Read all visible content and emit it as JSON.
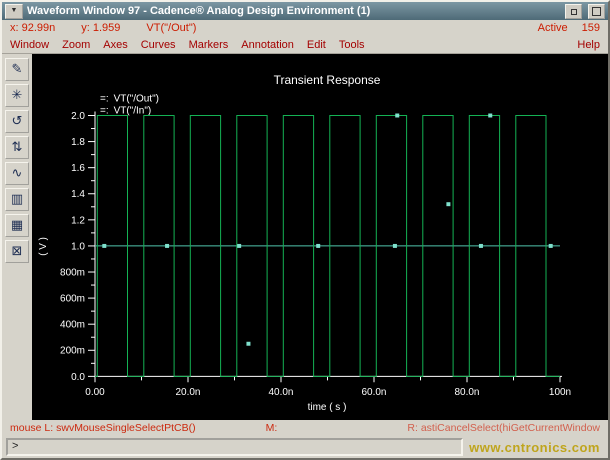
{
  "window": {
    "title": "Waveform Window 97 - Cadence® Analog Design Environment (1)"
  },
  "status_top": {
    "x": "x: 92.99n",
    "y": "y: 1.959",
    "trace": "VT(\"/Out\")",
    "active": "Active",
    "count": "159"
  },
  "menu": {
    "items": [
      "Window",
      "Zoom",
      "Axes",
      "Curves",
      "Markers",
      "Annotation",
      "Edit",
      "Tools"
    ],
    "help": "Help"
  },
  "toolbar": {
    "icons": [
      {
        "name": "probe-pen-icon",
        "glyph": "✎"
      },
      {
        "name": "asterisk-icon",
        "glyph": "✳"
      },
      {
        "name": "redraw-icon",
        "glyph": "↺"
      },
      {
        "name": "zoom-fit-icon",
        "glyph": "⇅"
      },
      {
        "name": "strip-wave-icon",
        "glyph": "∿"
      },
      {
        "name": "subwindow-icon",
        "glyph": "▥"
      },
      {
        "name": "grid-icon",
        "glyph": "▦"
      },
      {
        "name": "close-box-icon",
        "glyph": "⊠"
      }
    ]
  },
  "plot": {
    "title": "Transient Response",
    "legend_prefix": "=:",
    "ylabel": "( V )",
    "xlabel": "time ( s )"
  },
  "chart_data": {
    "type": "line",
    "title": "Transient Response",
    "xlabel": "time ( s )",
    "ylabel": "(V)",
    "xunit": "ns",
    "xlim": [
      0,
      100
    ],
    "ylim": [
      0,
      2
    ],
    "xticks": [
      "0.00",
      "20.0n",
      "40.0n",
      "60.0n",
      "80.0n",
      "100n"
    ],
    "yticks": [
      "2.0",
      "1.8",
      "1.6",
      "1.4",
      "1.2",
      "1.0",
      "800m",
      "600m",
      "400m",
      "200m",
      "0.0"
    ],
    "series": [
      {
        "name": "VT(\"/Out\")",
        "color": "#14b254",
        "points": [
          [
            0,
            0
          ],
          [
            0.5,
            0
          ],
          [
            0.5,
            2
          ],
          [
            7,
            2
          ],
          [
            7,
            0
          ],
          [
            10.5,
            0
          ],
          [
            10.5,
            2
          ],
          [
            17,
            2
          ],
          [
            17,
            0
          ],
          [
            20.5,
            0
          ],
          [
            20.5,
            2
          ],
          [
            27,
            2
          ],
          [
            27,
            0
          ],
          [
            30.5,
            0
          ],
          [
            30.5,
            2
          ],
          [
            37,
            2
          ],
          [
            37,
            0
          ],
          [
            40.5,
            0
          ],
          [
            40.5,
            2
          ],
          [
            47,
            2
          ],
          [
            47,
            0
          ],
          [
            50.5,
            0
          ],
          [
            50.5,
            2
          ],
          [
            57,
            2
          ],
          [
            57,
            0
          ],
          [
            60.5,
            0
          ],
          [
            60.5,
            2
          ],
          [
            67,
            2
          ],
          [
            67,
            0
          ],
          [
            70.5,
            0
          ],
          [
            70.5,
            2
          ],
          [
            77,
            2
          ],
          [
            77,
            0
          ],
          [
            80.5,
            0
          ],
          [
            80.5,
            2
          ],
          [
            87,
            2
          ],
          [
            87,
            0
          ],
          [
            90.5,
            0
          ],
          [
            90.5,
            2
          ],
          [
            97,
            2
          ],
          [
            97,
            0
          ],
          [
            100,
            0
          ]
        ]
      },
      {
        "name": "VT(\"/In\")",
        "color": "#52c5ae",
        "points": [
          [
            0,
            1
          ],
          [
            100,
            1
          ]
        ]
      }
    ],
    "marker_color": "#7fe0cc",
    "markers": [
      [
        2,
        1
      ],
      [
        15.5,
        1
      ],
      [
        31,
        1
      ],
      [
        33,
        0.25
      ],
      [
        48,
        1
      ],
      [
        64.5,
        1
      ],
      [
        65,
        2
      ],
      [
        76,
        1.32
      ],
      [
        83,
        1
      ],
      [
        85,
        2
      ],
      [
        98,
        1
      ]
    ]
  },
  "status_bottom": {
    "left": "mouse L:  swvMouseSingleSelectPtCB()",
    "mid": "M:",
    "right": "R: astiCancelSelect(hiGetCurrentWindow"
  },
  "prompt": {
    "symbol": ">"
  },
  "watermark": "www.cntronics.com"
}
